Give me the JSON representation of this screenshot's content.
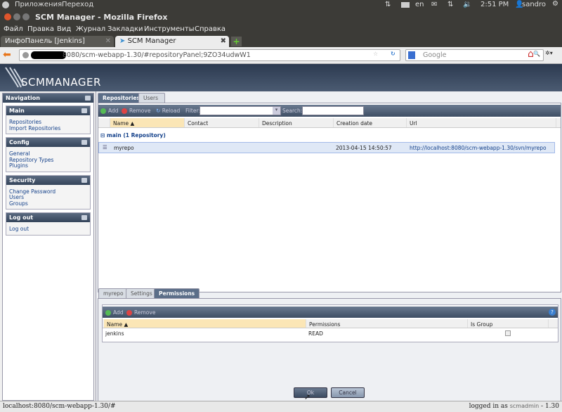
{
  "os": {
    "menu": [
      "Приложения",
      "Переход"
    ],
    "lang": "en",
    "time": "2:51 PM",
    "user": "sandro"
  },
  "window": {
    "title": "SCM Manager - Mozilla Firefox"
  },
  "menubar": [
    "Файл",
    "Правка",
    "Вид",
    "Журнал",
    "Закладки",
    "Инструменты",
    "Справка"
  ],
  "tabs": [
    {
      "label": "ИнфоПанель [Jenkins]"
    },
    {
      "label": "SCM Manager"
    }
  ],
  "url": "8080/scm-webapp-1.30/#repositoryPanel;9ZO34udwW1",
  "search_placeholder": "Google",
  "logo": "SCMMANAGER",
  "nav": {
    "title": "Navigation",
    "sections": [
      {
        "title": "Main",
        "items": [
          "Repositories",
          "Import Repositories"
        ]
      },
      {
        "title": "Config",
        "items": [
          "General",
          "Repository Types",
          "Plugins"
        ]
      },
      {
        "title": "Security",
        "items": [
          "Change Password",
          "Users",
          "Groups"
        ]
      },
      {
        "title": "Log out",
        "items": [
          "Log out"
        ]
      }
    ]
  },
  "main_tabs": [
    "Repositories",
    "Users"
  ],
  "toolbar": {
    "add": "Add",
    "remove": "Remove",
    "reload": "Reload",
    "filter": "Filter:",
    "search": "Search:"
  },
  "columns": [
    "Name ▲",
    "Contact",
    "Description",
    "Creation date",
    "Url"
  ],
  "group": "main (1 Repository)",
  "rows": [
    {
      "name": "myrepo",
      "contact": "",
      "description": "",
      "created": "2013-04-15 14:50:57",
      "url": "http://localhost:8080/scm-webapp-1.30/svn/myrepo"
    }
  ],
  "detail_tabs": [
    "myrepo",
    "Settings",
    "Permissions"
  ],
  "perm": {
    "add": "Add",
    "remove": "Remove",
    "columns": [
      "Name ▲",
      "Permissions",
      "Is Group"
    ],
    "rows": [
      {
        "name": "jenkins",
        "permission": "READ",
        "is_group": false
      }
    ]
  },
  "buttons": {
    "ok": "Ok",
    "cancel": "Cancel"
  },
  "status": {
    "url": "localhost:8080/scm-webapp-1.30/#",
    "logged_prefix": "logged in as",
    "user": "scmadmin",
    "version": "- 1.30"
  }
}
